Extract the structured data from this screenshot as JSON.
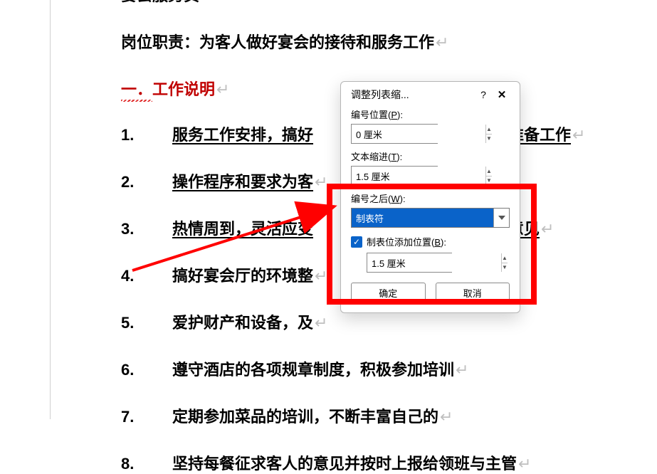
{
  "doc": {
    "title_line": "宴会服务员",
    "duty_line": "岗位职责：为客人做好宴会的接待和服务工作",
    "section_heading_prefix": "一．",
    "section_heading_text": "工作说明",
    "items": [
      {
        "num": "1.",
        "text": "服务工作安排，搞好",
        "tail": "作的准备工作",
        "underline": true
      },
      {
        "num": "2.",
        "text": "操作程序和要求为客",
        "tail": "",
        "underline": true
      },
      {
        "num": "3.",
        "text": "热情周到，灵活应变",
        "tail": "求和意见",
        "underline": true
      },
      {
        "num": "4.",
        "text": "搞好宴会厅的环境整",
        "tail": "",
        "underline": false
      },
      {
        "num": "5.",
        "text": "爱护财产和设备，及",
        "tail": "",
        "underline": false
      },
      {
        "num": "6.",
        "text": "遵守酒店的各项规章制度，积极参加培训",
        "tail": "",
        "underline": false
      },
      {
        "num": "7.",
        "text": "定期参加菜品的培训，不断丰富自己的",
        "tail": "",
        "underline": false
      },
      {
        "num": "8.",
        "text": "坚持每餐征求客人的意见并按时上报给领班与主管",
        "tail": "",
        "underline": false
      }
    ],
    "return_mark": "↵"
  },
  "dialog": {
    "title": "调整列表缩...",
    "help": "?",
    "close": "✕",
    "number_pos_label_pre": "编号位置(",
    "number_pos_key": "P",
    "number_pos_label_post": "):",
    "number_pos_value": "0 厘米",
    "text_indent_label_pre": "文本缩进(",
    "text_indent_key": "T",
    "text_indent_label_post": "):",
    "text_indent_value": "1.5 厘米",
    "after_number_label_pre": "编号之后(",
    "after_number_key": "W",
    "after_number_label_post": "):",
    "after_number_value": "制表符",
    "tab_stop_label_pre": "制表位添加位置(",
    "tab_stop_key": "B",
    "tab_stop_label_post": "):",
    "tab_stop_value": "1.5 厘米",
    "tab_stop_checked": true,
    "ok": "确定",
    "cancel": "取消"
  }
}
